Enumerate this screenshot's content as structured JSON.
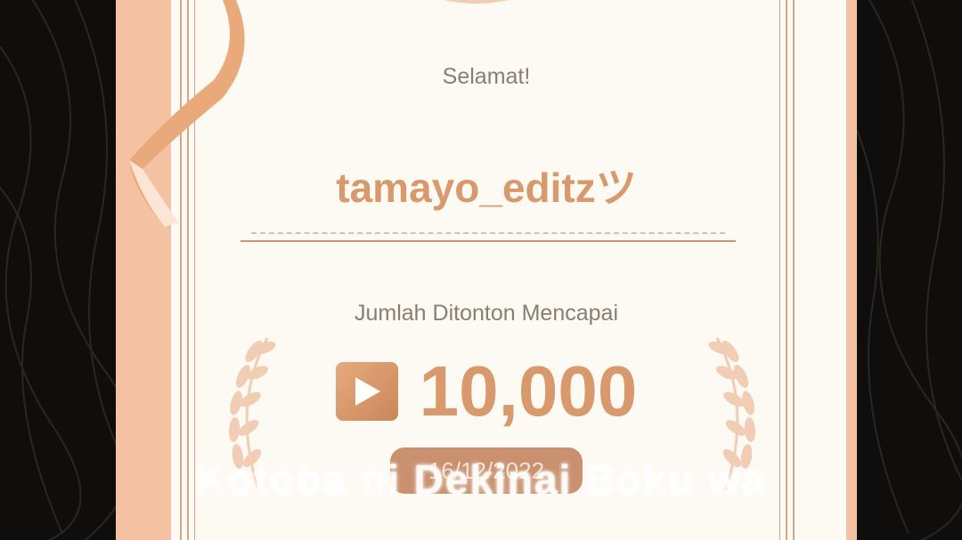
{
  "certificate": {
    "greeting": "Selamat!",
    "username": "tamayo_editzツ",
    "milestone_label": "Jumlah Ditonton Mencapai",
    "view_count": "10,000",
    "date": "16/12/2022"
  },
  "overlay": {
    "subtitle": "Kotoba ni Dekinai Boku wa"
  },
  "icons": {
    "play": "play-icon",
    "laurel": "laurel-wreath-icon",
    "ribbon": "ribbon-icon"
  },
  "colors": {
    "accent": "#d89a6c",
    "frame": "#f4c2a2",
    "paper": "#fdf9f3",
    "date_pill": "#c9916f"
  }
}
